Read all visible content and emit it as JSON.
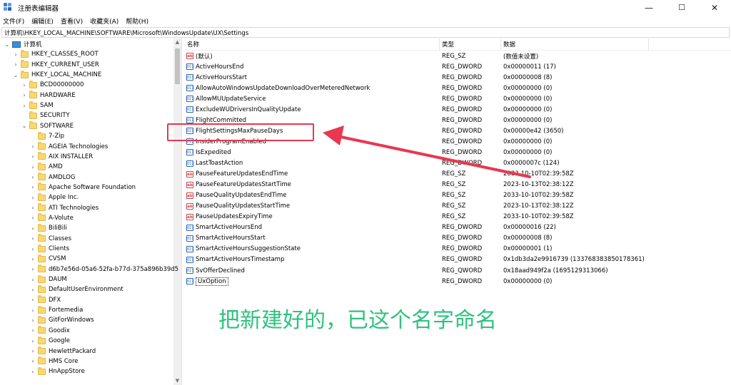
{
  "window": {
    "title": "注册表编辑器",
    "min": "—",
    "max": "☐",
    "close": "✕"
  },
  "menu": [
    "文件(F)",
    "编辑(E)",
    "查看(V)",
    "收藏夹(A)",
    "帮助(H)"
  ],
  "address": "计算机\\HKEY_LOCAL_MACHINE\\SOFTWARE\\Microsoft\\WindowsUpdate\\UX\\Settings",
  "tree": {
    "root": "计算机",
    "hives": [
      "HKEY_CLASSES_ROOT",
      "HKEY_CURRENT_USER",
      "HKEY_LOCAL_MACHINE"
    ],
    "hklm_children": [
      "BCD00000000",
      "HARDWARE",
      "SAM",
      "SECURITY",
      "SOFTWARE"
    ],
    "software_children": [
      "7-Zip",
      "AGEIA Technologies",
      "AIX INSTALLER",
      "AMD",
      "AMDLOG",
      "Apache Software Foundation",
      "Apple Inc.",
      "ATI Technologies",
      "A-Volute",
      "BiliBili",
      "Classes",
      "Clients",
      "CVSM",
      "d6b7e56d-05a6-52fa-b77d-375a896b39d5",
      "DAUM",
      "DefaultUserEnvironment",
      "DFX",
      "Fortemedia",
      "GitForWindows",
      "Goodix",
      "Google",
      "HewlettPackard",
      "HMS Core",
      "HnAppStore"
    ]
  },
  "columns": {
    "name": "名称",
    "type": "类型",
    "data": "数据"
  },
  "values": [
    {
      "name": "(默认)",
      "type": "REG_SZ",
      "data": "(数值未设置)",
      "icon": "string-icon"
    },
    {
      "name": "ActiveHoursEnd",
      "type": "REG_DWORD",
      "data": "0x00000011 (17)",
      "icon": "binary-icon"
    },
    {
      "name": "ActiveHoursStart",
      "type": "REG_DWORD",
      "data": "0x00000008 (8)",
      "icon": "binary-icon"
    },
    {
      "name": "AllowAutoWindowsUpdateDownloadOverMeteredNetwork",
      "type": "REG_DWORD",
      "data": "0x00000000 (0)",
      "icon": "binary-icon"
    },
    {
      "name": "AllowMUUpdateService",
      "type": "REG_DWORD",
      "data": "0x00000000 (0)",
      "icon": "binary-icon"
    },
    {
      "name": "ExcludeWUDriversInQualityUpdate",
      "type": "REG_DWORD",
      "data": "0x00000000 (0)",
      "icon": "binary-icon"
    },
    {
      "name": "FlightCommitted",
      "type": "REG_DWORD",
      "data": "0x00000000 (0)",
      "icon": "binary-icon"
    },
    {
      "name": "FlightSettingsMaxPauseDays",
      "type": "REG_DWORD",
      "data": "0x00000e42 (3650)",
      "icon": "binary-icon"
    },
    {
      "name": "InsiderProgramEnabled",
      "type": "REG_DWORD",
      "data": "0x00000000 (0)",
      "icon": "binary-icon"
    },
    {
      "name": "IsExpedited",
      "type": "REG_DWORD",
      "data": "0x00000000 (0)",
      "icon": "binary-icon"
    },
    {
      "name": "LastToastAction",
      "type": "REG_DWORD",
      "data": "0x0000007c (124)",
      "icon": "binary-icon"
    },
    {
      "name": "PauseFeatureUpdatesEndTime",
      "type": "REG_SZ",
      "data": "2033-10-10T02:39:58Z",
      "icon": "string-icon"
    },
    {
      "name": "PauseFeatureUpdatesStartTime",
      "type": "REG_SZ",
      "data": "2023-10-13T02:38:12Z",
      "icon": "string-icon"
    },
    {
      "name": "PauseQualityUpdatesEndTime",
      "type": "REG_SZ",
      "data": "2033-10-10T02:39:58Z",
      "icon": "string-icon"
    },
    {
      "name": "PauseQualityUpdatesStartTime",
      "type": "REG_SZ",
      "data": "2023-10-13T02:38:12Z",
      "icon": "string-icon"
    },
    {
      "name": "PauseUpdatesExpiryTime",
      "type": "REG_SZ",
      "data": "2033-10-10T02:39:58Z",
      "icon": "string-icon"
    },
    {
      "name": "SmartActiveHoursEnd",
      "type": "REG_DWORD",
      "data": "0x00000016 (22)",
      "icon": "binary-icon"
    },
    {
      "name": "SmartActiveHoursStart",
      "type": "REG_DWORD",
      "data": "0x00000008 (8)",
      "icon": "binary-icon"
    },
    {
      "name": "SmartActiveHoursSuggestionState",
      "type": "REG_DWORD",
      "data": "0x00000001 (1)",
      "icon": "binary-icon"
    },
    {
      "name": "SmartActiveHoursTimestamp",
      "type": "REG_QWORD",
      "data": "0x1db3da2e9916739 (133768383850178361)",
      "icon": "binary-icon"
    },
    {
      "name": "SvOfferDeclined",
      "type": "REG_QWORD",
      "data": "0x18aad949f2a (1695129313066)",
      "icon": "binary-icon"
    },
    {
      "name": "UxOption",
      "type": "REG_DWORD",
      "data": "0x00000000 (0)",
      "icon": "binary-icon"
    }
  ],
  "annotation": {
    "text": "把新建好的，已这个名字命名",
    "color": "#2ec27e",
    "highlight_color": "#e8384f"
  }
}
